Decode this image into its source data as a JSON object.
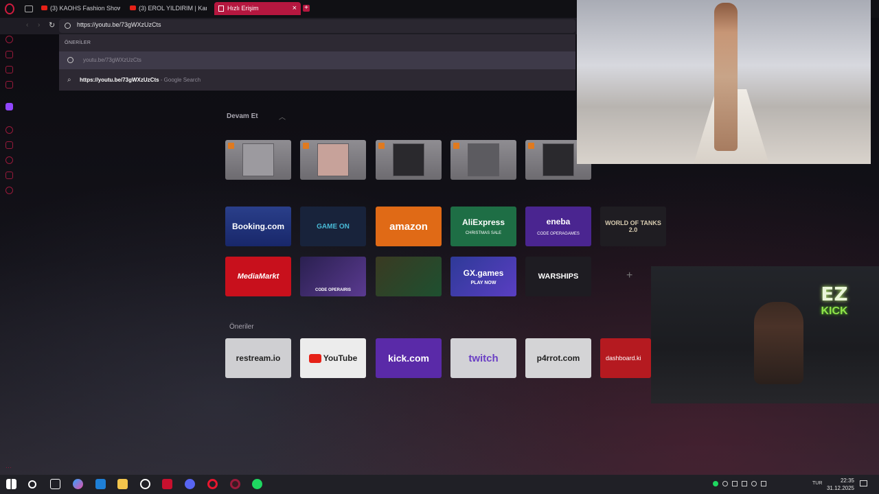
{
  "tabs": [
    {
      "label": "(3) KAOHS Fashion Show"
    },
    {
      "label": "(3) EROL YILDIRIM | Kans"
    },
    {
      "label": "Hızlı Erişim"
    }
  ],
  "address": {
    "value": "https://youtu.be/73gWXzUzCts"
  },
  "dropdown": {
    "header": "ÖNERİLER",
    "suggestion_1": "youtu.be/73gWXzUzCts",
    "suggestion_2_main": "https://youtu.be/73gWXzUzCts",
    "suggestion_2_sep": " - ",
    "suggestion_2_engine": "Google Search"
  },
  "sections": {
    "continue": "Devam Et",
    "suggestions": "Öneriler"
  },
  "speed_dial": [
    {
      "label": "Booking.com"
    },
    {
      "label": "GAME ON"
    },
    {
      "label": "amazon"
    },
    {
      "label": "AliExpress",
      "sub": "CHRISTMAS SALE"
    },
    {
      "label": "eneba",
      "sub": "CODE OPERAGAMES"
    },
    {
      "label": "WORLD OF TANKS 2.0"
    },
    {
      "label": "MediaMarkt"
    },
    {
      "label": "CODE OPERAIRIS"
    },
    {
      "label": ""
    },
    {
      "label": "GX.games",
      "sub": "PLAY NOW"
    },
    {
      "label": "WARSHIPS"
    }
  ],
  "suggested_sites": [
    {
      "label": "restream.io"
    },
    {
      "label": "YouTube"
    },
    {
      "label": "kick.com"
    },
    {
      "label": "twitch"
    },
    {
      "label": "p4rrot.com"
    },
    {
      "label": "dashboard.ki"
    }
  ],
  "overlay": {
    "ez": "EZ",
    "kick": "KICK"
  },
  "taskbar": {
    "lang": "TUR",
    "time": "22:35",
    "date": "31.12.2025"
  }
}
